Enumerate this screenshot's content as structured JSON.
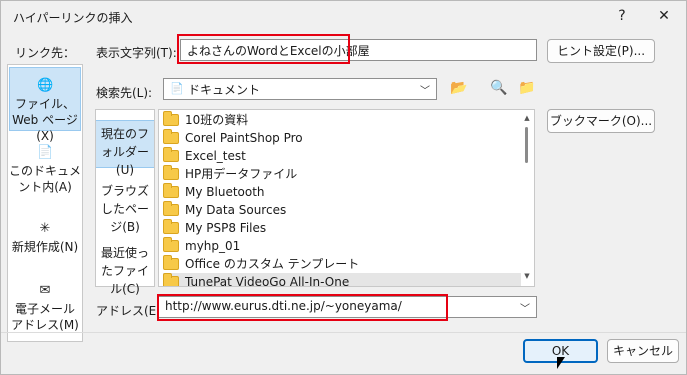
{
  "window": {
    "title": "ハイパーリンクの挿入",
    "help_button": "?",
    "close_button": "✕"
  },
  "link_to": {
    "label": "リンク先：",
    "items": [
      {
        "label": "ファイル、Web ページ(X)",
        "icon": "web-page-icon",
        "selected": true
      },
      {
        "label": "このドキュメント内(A)",
        "icon": "document-icon",
        "selected": false
      },
      {
        "label": "新規作成(N)",
        "icon": "new-document-icon",
        "selected": false
      },
      {
        "label": "電子メール アドレス(M)",
        "icon": "email-icon",
        "selected": false
      }
    ]
  },
  "display_text": {
    "label": "表示文字列(T):",
    "value": "よねさんのWordとExcelの小部屋"
  },
  "screentip_button": "ヒント設定(P)...",
  "look_in": {
    "label": "検索先(L):",
    "value": "ドキュメント"
  },
  "look_in_bar": [
    {
      "label": "現在のフォルダー(U)",
      "selected": true
    },
    {
      "label": "ブラウズしたページ(B)",
      "selected": false
    },
    {
      "label": "最近使ったファイル(C)",
      "selected": false
    }
  ],
  "files": [
    "10班の資料",
    "Corel PaintShop Pro",
    "Excel_test",
    "HP用データファイル",
    "My Bluetooth",
    "My Data Sources",
    "My PSP8 Files",
    "myhp_01",
    "Office のカスタム テンプレート",
    "TunePat VideoGo All-In-One"
  ],
  "bookmark_button": "ブックマーク(O)...",
  "address": {
    "label": "アドレス(E):",
    "value": "http://www.eurus.dti.ne.jp/~yoneyama/"
  },
  "ok_button": "OK",
  "cancel_button": "キャンセル",
  "colors": {
    "highlight_box": "#e60012",
    "accent": "#0067c0",
    "selection": "#cce4f7"
  }
}
